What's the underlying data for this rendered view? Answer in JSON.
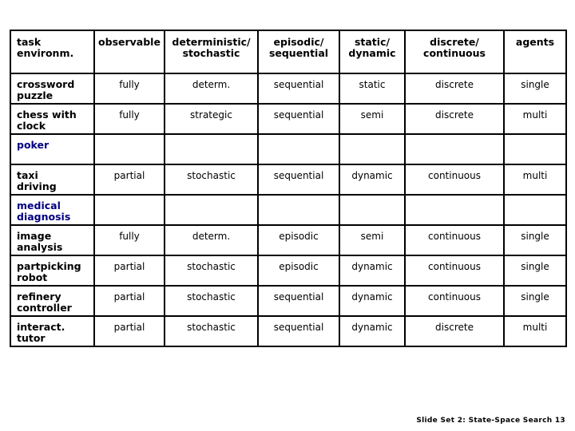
{
  "slide": {
    "footer": "Slide Set 2: State-Space Search  13",
    "highlight_color": "#000080",
    "text_color": "#000000",
    "border_color": "#000000",
    "background": "#ffffff"
  },
  "table": {
    "headers": [
      "task\nenvironm.",
      "observable",
      "deterministic/\nstochastic",
      "episodic/\nsequential",
      "static/\ndynamic",
      "discrete/\ncontinuous",
      "agents"
    ],
    "rows": [
      {
        "label": "crossword\npuzzle",
        "highlight": false,
        "cells": [
          "fully",
          "determ.",
          "sequential",
          "static",
          "discrete",
          "single"
        ]
      },
      {
        "label": "chess with\nclock",
        "highlight": false,
        "cells": [
          "fully",
          "strategic",
          "sequential",
          "semi",
          "discrete",
          "multi"
        ]
      },
      {
        "label": "poker",
        "highlight": true,
        "cells": [
          "",
          "",
          "",
          "",
          "",
          ""
        ]
      },
      {
        "label": "taxi\ndriving",
        "highlight": false,
        "cells": [
          "partial",
          "stochastic",
          "sequential",
          "dynamic",
          "continuous",
          "multi"
        ]
      },
      {
        "label": "medical\ndiagnosis",
        "highlight": true,
        "cells": [
          "",
          "",
          "",
          "",
          "",
          ""
        ]
      },
      {
        "label": "image\nanalysis",
        "highlight": false,
        "cells": [
          "fully",
          "determ.",
          "episodic",
          "semi",
          "continuous",
          "single"
        ]
      },
      {
        "label": "partpicking\nrobot",
        "highlight": false,
        "cells": [
          "partial",
          "stochastic",
          "episodic",
          "dynamic",
          "continuous",
          "single"
        ]
      },
      {
        "label": "refinery\ncontroller",
        "highlight": false,
        "cells": [
          "partial",
          "stochastic",
          "sequential",
          "dynamic",
          "continuous",
          "single"
        ]
      },
      {
        "label": "interact.\ntutor",
        "highlight": false,
        "cells": [
          "partial",
          "stochastic",
          "sequential",
          "dynamic",
          "discrete",
          "multi"
        ]
      }
    ]
  }
}
